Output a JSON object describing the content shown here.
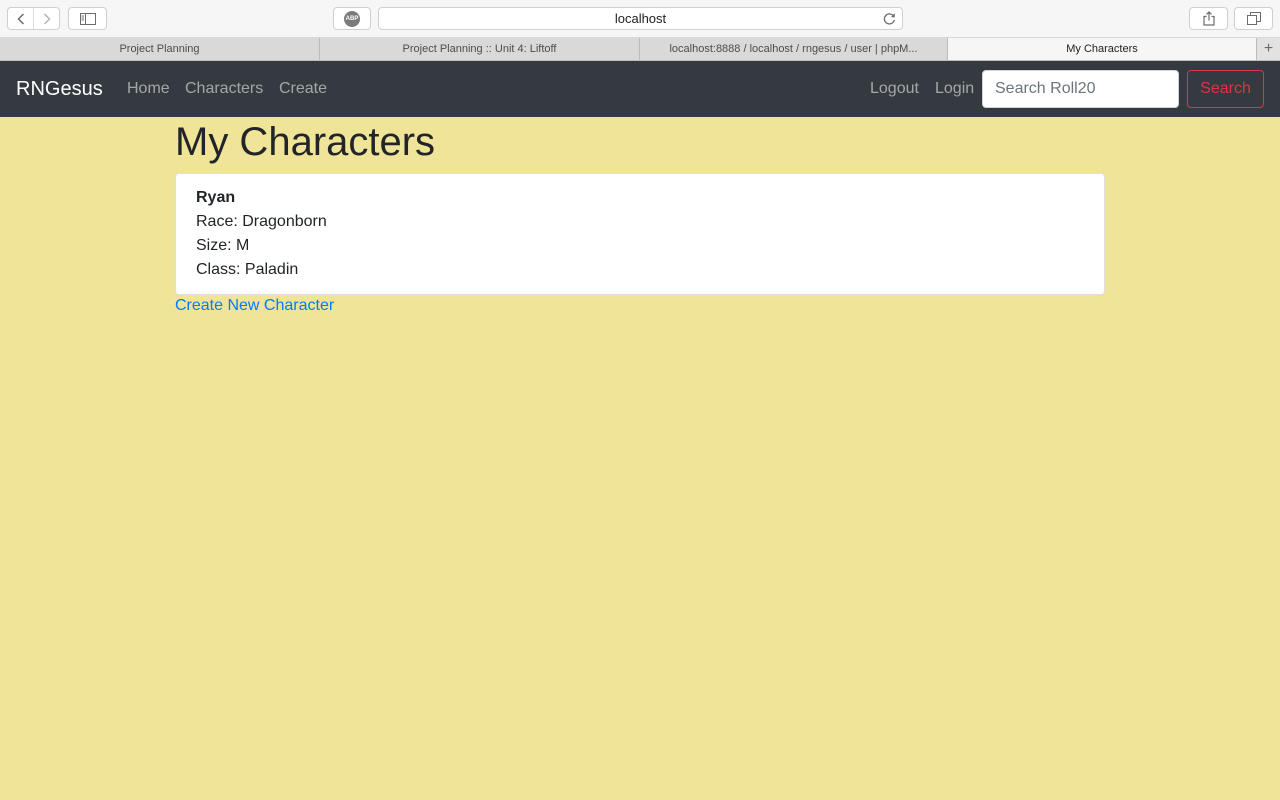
{
  "browser": {
    "url": "localhost",
    "abp_label": "ABP",
    "tabs": [
      {
        "label": "Project Planning"
      },
      {
        "label": "Project Planning :: Unit 4: Liftoff"
      },
      {
        "label": "localhost:8888 / localhost / rngesus / user | phpM..."
      },
      {
        "label": "My Characters"
      }
    ],
    "new_tab_label": "+"
  },
  "navbar": {
    "brand": "RNGesus",
    "links": [
      {
        "label": "Home"
      },
      {
        "label": "Characters"
      },
      {
        "label": "Create"
      }
    ],
    "right_links": [
      {
        "label": "Logout"
      },
      {
        "label": "Login"
      }
    ],
    "search_placeholder": "Search Roll20",
    "search_button": "Search"
  },
  "main": {
    "title": "My Characters",
    "characters": [
      {
        "name": "Ryan",
        "race": "Race: Dragonborn",
        "size": "Size: M",
        "class": "Class: Paladin"
      }
    ],
    "create_link": "Create New Character"
  },
  "colors": {
    "page_background": "#f0e499",
    "navbar_background": "#343a40",
    "link": "#007bff",
    "search_button": "#dc3545"
  }
}
